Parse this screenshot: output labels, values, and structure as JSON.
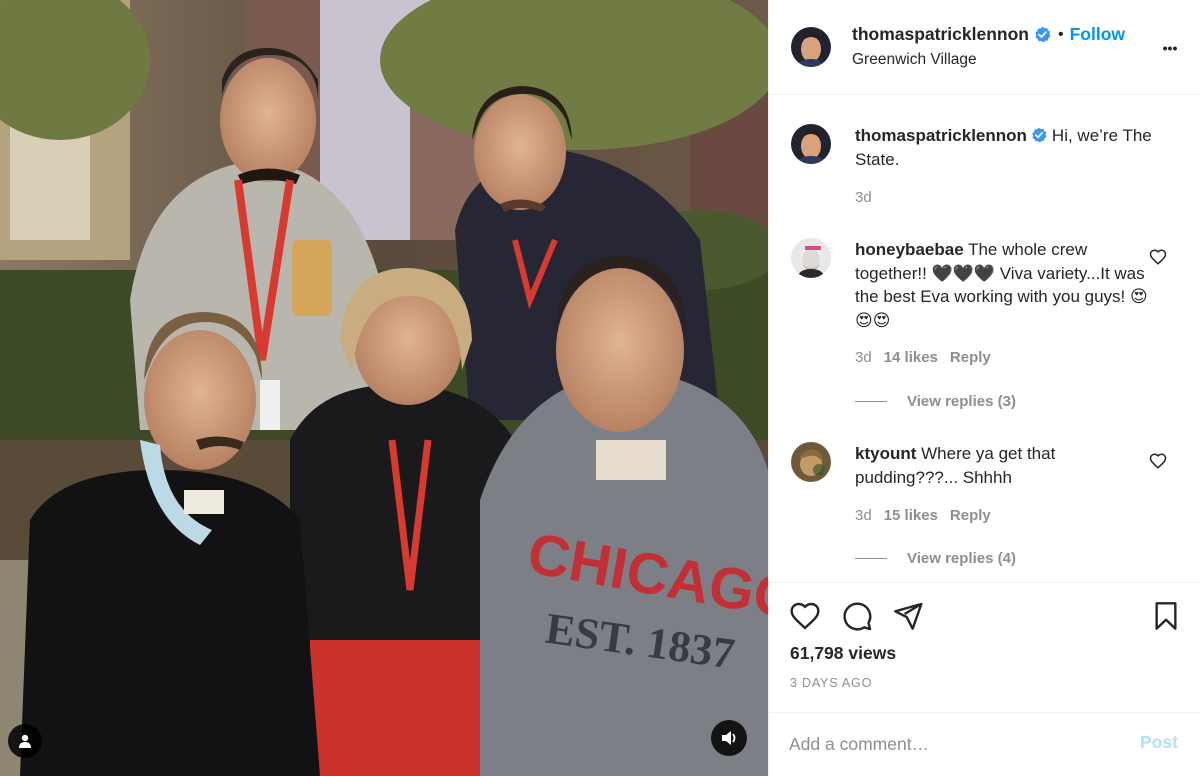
{
  "media": {
    "jersey_text": "CHICAGO",
    "jersey_sub": "EST. 1837",
    "tag_icon": "user-tag-icon",
    "sound_icon": "speaker-icon"
  },
  "header": {
    "username": "thomaspatricklennon",
    "separator": "•",
    "follow_label": "Follow",
    "location": "Greenwich Village",
    "more_icon": "more-icon",
    "more_glyph": "•••"
  },
  "caption": {
    "username": "thomaspatricklennon",
    "text": "Hi, we’re The State.",
    "time": "3d"
  },
  "comments": [
    {
      "username": "honeybaebae",
      "text": "The whole crew together!! 🖤🖤🖤 Viva variety...It was the best Eva working with you guys! 😍😍😍",
      "time": "3d",
      "likes": "14 likes",
      "reply_label": "Reply",
      "view_replies": "View replies (3)"
    },
    {
      "username": "ktyount",
      "text": "Where ya get that pudding???... Shhhh",
      "time": "3d",
      "likes": "15 likes",
      "reply_label": "Reply",
      "view_replies": "View replies (4)"
    }
  ],
  "actions": {
    "like_icon": "heart-icon",
    "comment_icon": "comment-icon",
    "share_icon": "send-icon",
    "save_icon": "bookmark-icon",
    "views": "61,798 views",
    "date": "3 DAYS AGO"
  },
  "add_comment": {
    "placeholder": "Add a comment…",
    "post_label": "Post"
  },
  "colors": {
    "link_blue": "#0095f6",
    "post_disabled": "#b2dffc",
    "muted": "#8e8e8e",
    "border": "#efefef"
  }
}
